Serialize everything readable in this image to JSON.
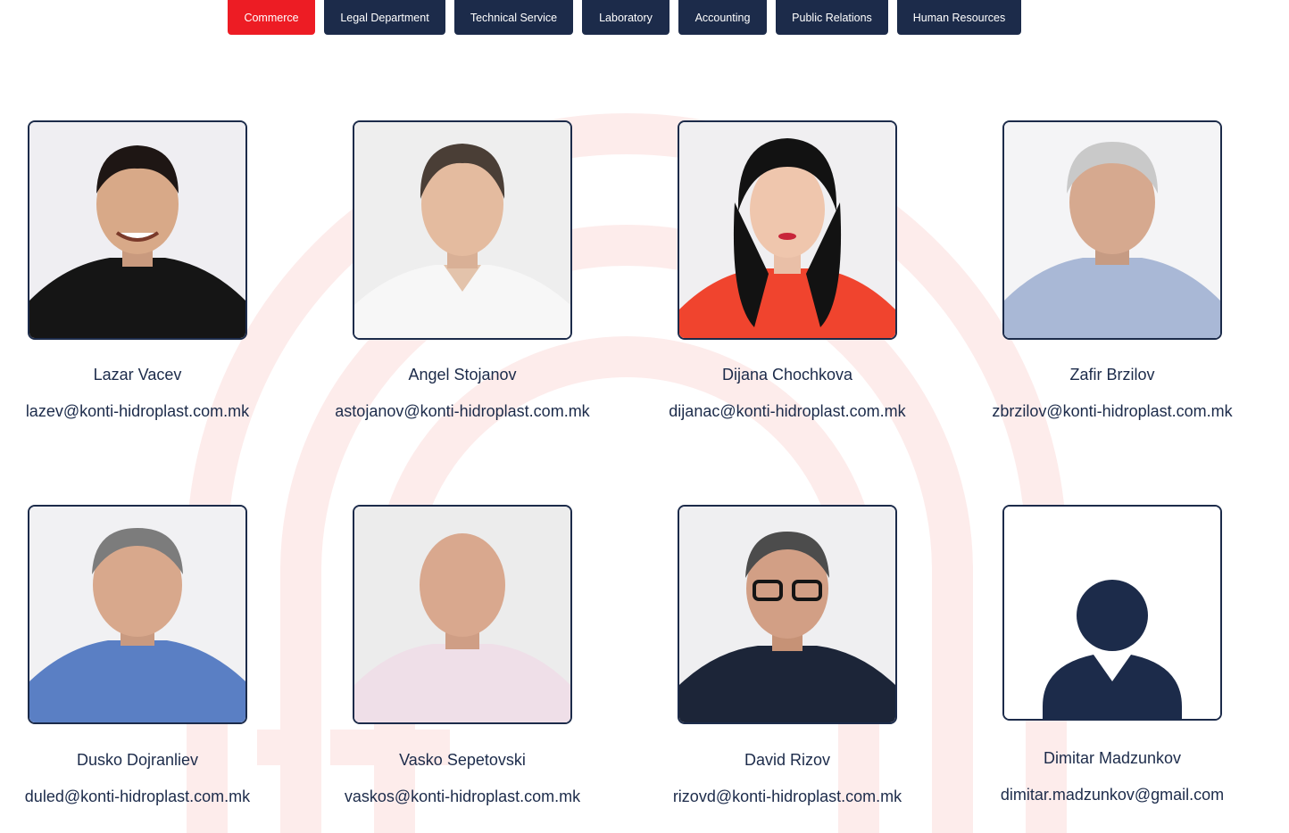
{
  "tabs": [
    {
      "label": "Commerce",
      "active": true
    },
    {
      "label": "Legal Department",
      "active": false
    },
    {
      "label": "Technical Service",
      "active": false
    },
    {
      "label": "Laboratory",
      "active": false
    },
    {
      "label": "Accounting",
      "active": false
    },
    {
      "label": "Public Relations",
      "active": false
    },
    {
      "label": "Human Resources",
      "active": false
    }
  ],
  "colors": {
    "accent": "#ed1c24",
    "navy": "#1c2b4a",
    "watermark": "#fdeceb"
  },
  "employees": [
    {
      "name": "Lazar Vacev",
      "email": "lazev@konti-hidroplast.com.mk",
      "photo": "portrait-photo"
    },
    {
      "name": "Angel Stojanov",
      "email": "astojanov@konti-hidroplast.com.mk",
      "photo": "portrait-photo"
    },
    {
      "name": "Dijana Chochkova",
      "email": "dijanac@konti-hidroplast.com.mk",
      "photo": "portrait-photo"
    },
    {
      "name": "Zafir Brzilov",
      "email": "zbrzilov@konti-hidroplast.com.mk",
      "photo": "portrait-photo"
    },
    {
      "name": "Dusko Dojranliev",
      "email": "duled@konti-hidroplast.com.mk",
      "photo": "portrait-photo"
    },
    {
      "name": "Vasko Sepetovski",
      "email": "vaskos@konti-hidroplast.com.mk",
      "photo": "portrait-photo"
    },
    {
      "name": "David Rizov",
      "email": "rizovd@konti-hidroplast.com.mk",
      "photo": "portrait-photo"
    },
    {
      "name": "Dimitar Madzunkov",
      "email": "dimitar.madzunkov@gmail.com",
      "photo": "avatar-placeholder-icon"
    }
  ]
}
